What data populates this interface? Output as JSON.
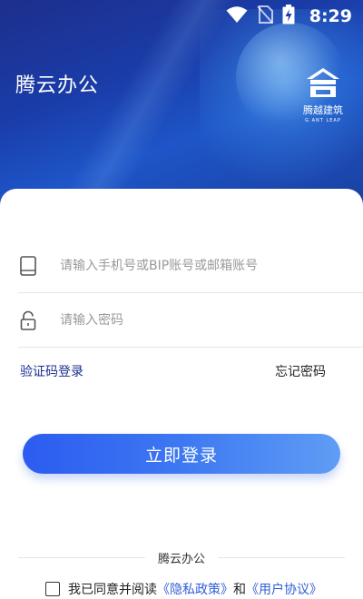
{
  "status_bar": {
    "time": "8:29",
    "icons": [
      "wifi-icon",
      "no-sim-icon",
      "battery-charging-icon"
    ]
  },
  "header": {
    "app_title": "腾云办公",
    "logo": {
      "name": "腾越建筑",
      "subtitle": "G ANT LEAP"
    }
  },
  "form": {
    "account_field": {
      "icon": "phone-icon",
      "placeholder": "请输入手机号或BIP账号或邮箱账号"
    },
    "password_field": {
      "icon": "lock-icon",
      "placeholder": "请输入密码"
    },
    "sms_login_label": "验证码登录",
    "forgot_password_label": "忘记密码",
    "login_button_label": "立即登录"
  },
  "footer": {
    "brand_label": "腾云办公",
    "agreement": {
      "prefix": "我已同意并阅读",
      "privacy_link": "《隐私政策》",
      "conjunction": "和",
      "user_agreement_link": "《用户协议》",
      "checked": false
    }
  },
  "colors": {
    "header_blue": "#1d3ca8",
    "button_start": "#2c5cf0",
    "button_end": "#5f9df5",
    "sms_link": "#1a2f8f",
    "agreement_link": "#2f5fd6"
  }
}
